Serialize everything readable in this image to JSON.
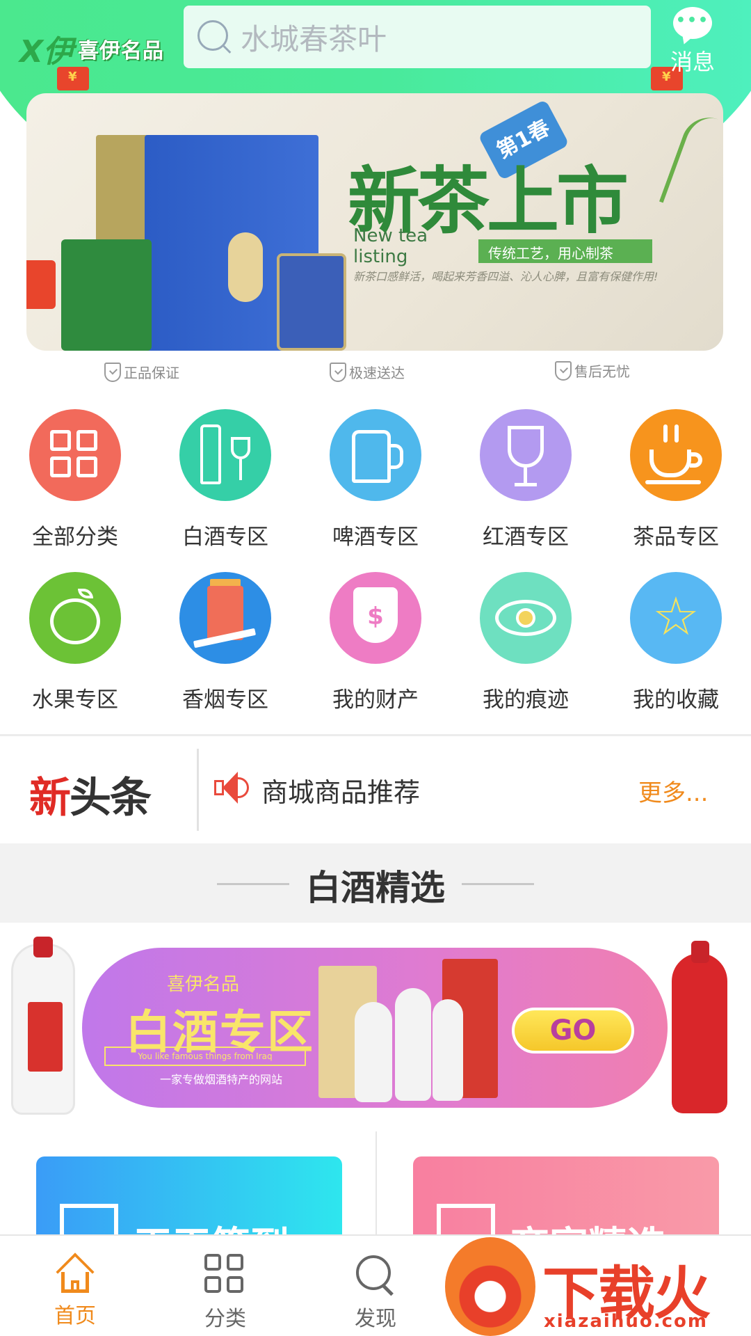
{
  "header": {
    "logo_text": "喜伊名品",
    "search_placeholder": "水城春茶叶",
    "message_label": "消息",
    "message_dots": "•••"
  },
  "banner": {
    "title": "新茶上市",
    "tag": "第1春",
    "english": "New tea listing",
    "strip": "传统工艺，用心制茶",
    "desc": "新茶口感鲜活，喝起来芳香四溢、沁人心脾，且富有保健作用!"
  },
  "guarantees": [
    "正品保证",
    "极速送达",
    "售后无忧"
  ],
  "categories": [
    {
      "label": "全部分类",
      "color": "#f26a5b",
      "icon": "grid-icon"
    },
    {
      "label": "白酒专区",
      "color": "#35cfa7",
      "icon": "bottle-glass-icon"
    },
    {
      "label": "啤酒专区",
      "color": "#4fb8ec",
      "icon": "beer-mug-icon"
    },
    {
      "label": "红酒专区",
      "color": "#b39af0",
      "icon": "wine-glass-icon"
    },
    {
      "label": "茶品专区",
      "color": "#f7941d",
      "icon": "tea-cup-icon"
    },
    {
      "label": "水果专区",
      "color": "#6cc236",
      "icon": "apple-icon"
    },
    {
      "label": "香烟专区",
      "color": "#2d8ee5",
      "icon": "cigarette-icon"
    },
    {
      "label": "我的财产",
      "color": "#ee7cc4",
      "icon": "money-shield-icon"
    },
    {
      "label": "我的痕迹",
      "color": "#6ee0c0",
      "icon": "eye-icon"
    },
    {
      "label": "我的收藏",
      "color": "#58b8f3",
      "icon": "star-icon"
    }
  ],
  "headline": {
    "logo_red": "新",
    "logo_dark": "头条",
    "text": "商城商品推荐",
    "more": "更多..."
  },
  "section": {
    "title": "白酒精选"
  },
  "promo": {
    "brand": "喜伊名品",
    "title": "白酒专区",
    "english": "You like famous things from Iraq",
    "subtitle": "一家专做烟酒特产的网站",
    "go": "GO"
  },
  "cards": [
    {
      "title": "天天签到",
      "color_from": "#3a9cf7",
      "color_to": "#2ee6ee"
    },
    {
      "title": "商家精选",
      "color_from": "#f87fa0",
      "color_to": "#f99aa8"
    }
  ],
  "bottom_nav": {
    "home": "首页",
    "category": "分类",
    "discover": "发现"
  },
  "watermark": {
    "text": "下载火",
    "url": "xiazaihuo.com"
  },
  "colors": {
    "accent_orange": "#f08a1c",
    "header_green": "#4be88d"
  }
}
